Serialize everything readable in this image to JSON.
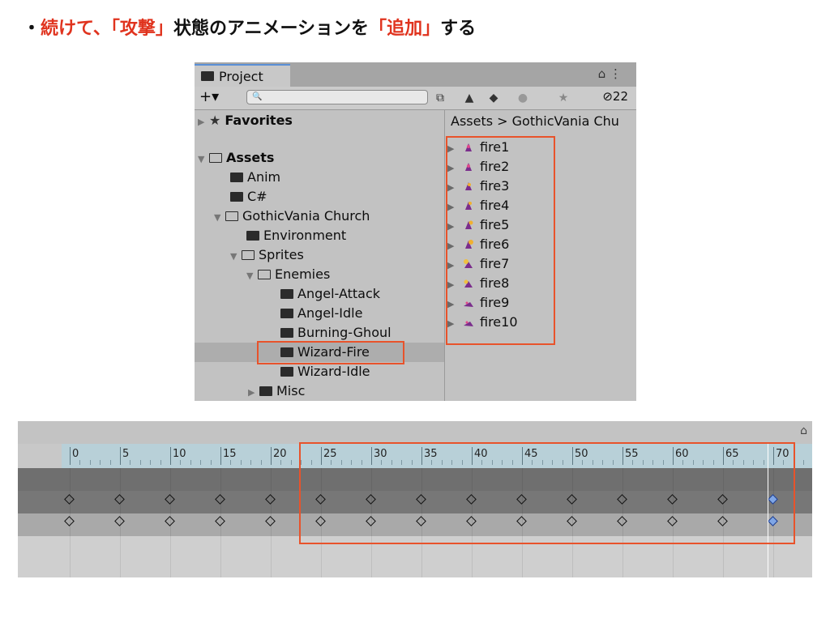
{
  "heading": {
    "bullet": "・",
    "part1": "続けて、",
    "part2": "「攻撃」",
    "part3": "状態のアニメーションを",
    "part4": "「追加」",
    "part5": "する"
  },
  "project_window": {
    "tab_label": "Project",
    "tab_controls": "⌂ ⋮",
    "add_button": "+▾",
    "search_placeholder": "",
    "hidden_count": "22",
    "favorites_label": "Favorites",
    "tree": [
      {
        "label": "Assets",
        "bold": true
      },
      {
        "label": "Anim"
      },
      {
        "label": "C#"
      },
      {
        "label": "GothicVania Church"
      },
      {
        "label": "Environment"
      },
      {
        "label": "Sprites"
      },
      {
        "label": "Enemies"
      },
      {
        "label": "Angel-Attack"
      },
      {
        "label": "Angel-Idle"
      },
      {
        "label": "Burning-Ghoul"
      },
      {
        "label": "Wizard-Fire",
        "selected": true
      },
      {
        "label": "Wizard-Idle"
      },
      {
        "label": "Misc"
      }
    ],
    "breadcrumb": "Assets > GothicVania Chu",
    "assets": [
      "fire1",
      "fire2",
      "fire3",
      "fire4",
      "fire5",
      "fire6",
      "fire7",
      "fire8",
      "fire9",
      "fire10"
    ],
    "highlight_color": "#e8532b"
  },
  "timeline": {
    "tick_labels": [
      "0",
      "5",
      "10",
      "15",
      "20",
      "25",
      "30",
      "35",
      "40",
      "45",
      "50",
      "55",
      "60",
      "65",
      "70"
    ],
    "keyframe_rows": 2,
    "keyframes_per_row": 15,
    "selected_keyframe_index": 14,
    "selected_key_color": "#7fa6e6"
  }
}
